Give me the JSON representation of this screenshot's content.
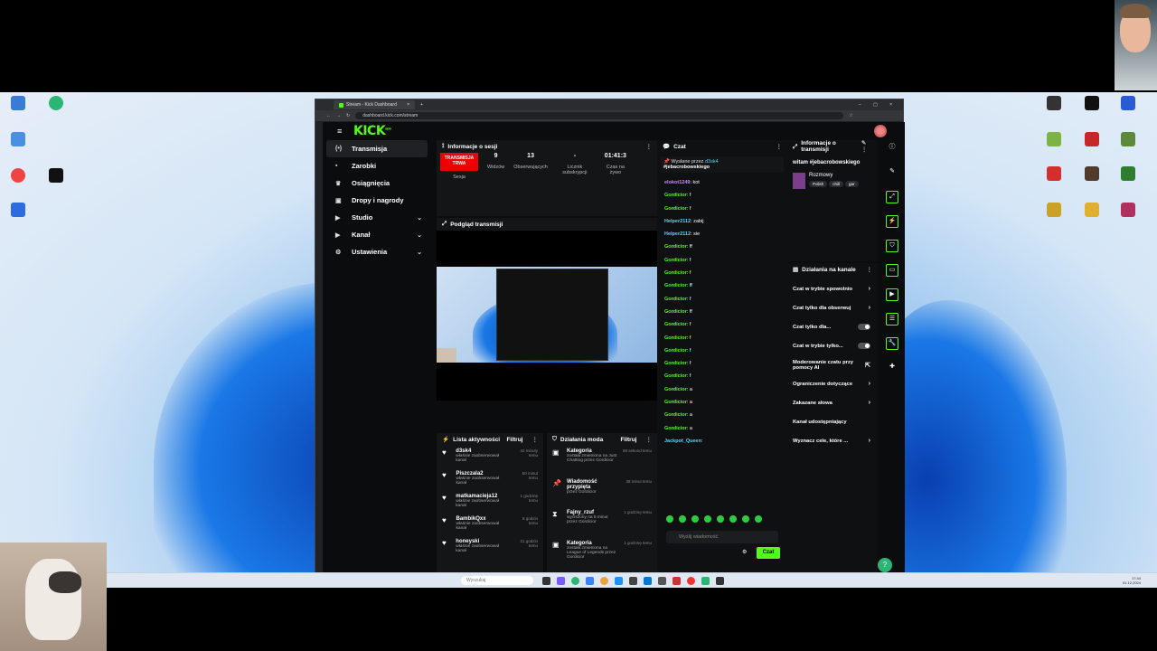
{
  "browser": {
    "tab_title": "Stream - Kick Dashboard",
    "url": "dashboard.kick.com/stream"
  },
  "kick": {
    "logo": "KICK",
    "logo_badge": "BETA",
    "nav": [
      {
        "label": "Transmisja",
        "icon": "(•)",
        "active": true
      },
      {
        "label": "Zarobki",
        "icon": "▪"
      },
      {
        "label": "Osiągnięcia",
        "icon": "♛"
      },
      {
        "label": "Dropy i nagrody",
        "icon": "▣"
      },
      {
        "label": "Studio",
        "icon": "▶",
        "chevron": "⌄"
      },
      {
        "label": "Kanał",
        "icon": "▶",
        "chevron": "⌄"
      },
      {
        "label": "Ustawienia",
        "icon": "⚙",
        "chevron": "⌄"
      }
    ]
  },
  "session": {
    "title": "Informacje o sesji",
    "live_badge": "TRANSMISJA TRWA",
    "live_label": "Sesja",
    "viewers": "9",
    "viewers_label": "Widzów",
    "followers": "13",
    "followers_label": "Obserwujących",
    "subs": "-",
    "subs_label": "Licznik subskrypcji",
    "time": "01:41:3",
    "time_label": "Czas na żywo"
  },
  "preview": {
    "title": "Podgląd transmisji"
  },
  "activity": {
    "title": "Lista aktywności",
    "filter": "Filtruj",
    "items": [
      {
        "name": "d3sk4",
        "sub": "właśnie zaobserwował kanał",
        "time": "42 minuty temu"
      },
      {
        "name": "Piszczala2",
        "sub": "właśnie zaobserwował kanał",
        "time": "50 minut temu"
      },
      {
        "name": "matkamacieja12",
        "sub": "właśnie zaobserwował kanał",
        "time": "1 godzinę temu"
      },
      {
        "name": "BambikQxx",
        "sub": "właśnie zaobserwował kanał",
        "time": "8 godzin temu"
      },
      {
        "name": "honeyski",
        "sub": "właśnie zaobserwował kanał",
        "time": "21 godzin temu"
      }
    ]
  },
  "modactions": {
    "title": "Działania moda",
    "filter": "Filtruj",
    "items": [
      {
        "name": "Kategoria",
        "sub": "została zmieniona na Just Chatting przez Gordicior",
        "time": "59 sekund temu"
      },
      {
        "name": "Wiadomość przypięta",
        "sub": "przez Gordicior",
        "time": "38 minut temu"
      },
      {
        "name": "Fajny_rzuf",
        "sub": "wyciszony na 5 minut przez Gordicior",
        "time": "1 godzinę temu"
      },
      {
        "name": "Kategoria",
        "sub": "została zmieniona na League of Legends przez Gordicior",
        "time": "1 godzinę temu"
      }
    ]
  },
  "chat": {
    "title": "Czat",
    "pinned_by": "Wysłane przez",
    "pinned_user": "d3sk4",
    "pinned_text": "#jebacrobowskiego",
    "messages": [
      {
        "user": "elokot1249",
        "text": "kot",
        "style": "u3"
      },
      {
        "user": "Gordicior",
        "text": "f",
        "style": "u"
      },
      {
        "user": "Gordicior",
        "text": "f",
        "style": "u"
      },
      {
        "user": "Helper2112",
        "text": "zabij",
        "style": "u2"
      },
      {
        "user": "Helper2112",
        "text": "sie",
        "style": "u2"
      },
      {
        "user": "Gordicior",
        "text": "ff",
        "style": "u"
      },
      {
        "user": "Gordicior",
        "text": "f",
        "style": "u"
      },
      {
        "user": "Gordicior",
        "text": "f",
        "style": "u"
      },
      {
        "user": "Gordicior",
        "text": "ff",
        "style": "u"
      },
      {
        "user": "Gordicior",
        "text": "f",
        "style": "u"
      },
      {
        "user": "Gordicior",
        "text": "ff",
        "style": "u"
      },
      {
        "user": "Gordicior",
        "text": "f",
        "style": "u"
      },
      {
        "user": "Gordicior",
        "text": "f",
        "style": "u"
      },
      {
        "user": "Gordicior",
        "text": "f",
        "style": "u"
      },
      {
        "user": "Gordicior",
        "text": "f",
        "style": "u"
      },
      {
        "user": "Gordicior",
        "text": "f",
        "style": "u"
      },
      {
        "user": "Gordicior",
        "text": "a",
        "style": "u"
      },
      {
        "user": "Gordicior",
        "text": "a",
        "style": "u"
      },
      {
        "user": "Gordicior",
        "text": "a",
        "style": "u"
      },
      {
        "user": "Gordicior",
        "text": "a",
        "style": "u"
      },
      {
        "user": "Jackpot_Queen",
        "text": "",
        "style": "u2"
      }
    ],
    "input_placeholder": "Wyślij wiadomość",
    "send": "Czat"
  },
  "streaminfo": {
    "title": "Informacje o transmisji",
    "stream_title": "witam #jebacrobowskiego",
    "category": "Rozmowy",
    "tags": [
      "Polish",
      "chill",
      "gar"
    ]
  },
  "channel_actions": {
    "title": "Działania na kanale",
    "items": [
      {
        "label": "Czat w trybie spowolnio",
        "type": "arrow"
      },
      {
        "label": "Czat tylko dla obserwuj",
        "type": "arrow"
      },
      {
        "label": "Czat tylko dla...",
        "type": "toggle"
      },
      {
        "label": "Czat w trybie tylko...",
        "type": "toggle"
      },
      {
        "label": "Moderowanie czatu przy pomocy AI",
        "type": "link"
      },
      {
        "label": "Ograniczenie dotyczące",
        "type": "arrow"
      },
      {
        "label": "Zakazane słowa",
        "type": "arrow"
      },
      {
        "label": "Kanał udostępniający",
        "type": "none"
      },
      {
        "label": "Wyznacz cele, które ...",
        "type": "arrow"
      }
    ]
  },
  "desktop": {
    "taskbar_search": "Wyszukaj",
    "clock_time": "17:44",
    "clock_date": "01.12.2024"
  },
  "colors": {
    "kick_green": "#53fc18",
    "live_red": "#e00000"
  }
}
